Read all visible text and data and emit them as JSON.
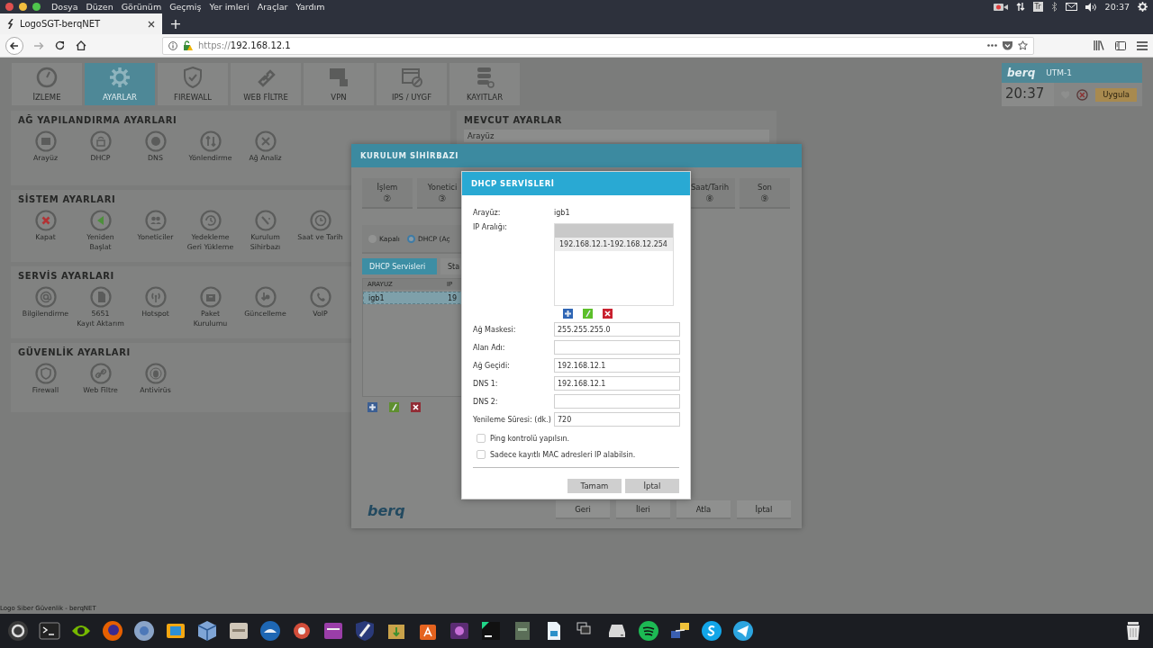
{
  "os_menu": [
    "Dosya",
    "Düzen",
    "Görünüm",
    "Geçmiş",
    "Yer imleri",
    "Araçlar",
    "Yardım"
  ],
  "os_tray": {
    "keyboard": "Tr",
    "clock": "20:37"
  },
  "browser": {
    "tab_title": "LogoSGT-berqNET",
    "new_tab": "+",
    "url_scheme": "https://",
    "url_host": "192.168.12.1"
  },
  "nav_tiles": [
    {
      "label": "İZLEME",
      "selected": false
    },
    {
      "label": "AYARLAR",
      "selected": true
    },
    {
      "label": "FIREWALL",
      "selected": false
    },
    {
      "label": "WEB FİLTRE",
      "selected": false
    },
    {
      "label": "VPN",
      "selected": false
    },
    {
      "label": "IPS / UYGF",
      "selected": false
    },
    {
      "label": "KAYITLAR",
      "selected": false
    }
  ],
  "device_widget": {
    "brand": "berq",
    "model": "UTM-1",
    "clock": "20:37",
    "apply": "Uygula"
  },
  "sections": [
    {
      "title": "AĞ YAPILANDIRMA AYARLARI",
      "items": [
        "Arayüz",
        "DHCP",
        "DNS",
        "Yönlendirme",
        "Ağ Analiz"
      ]
    },
    {
      "title": "SİSTEM AYARLARI",
      "items": [
        "Kapat",
        "Yeniden\nBaşlat",
        "Yoneticiler",
        "Yedekleme\nGeri Yükleme",
        "Kurulum\nSihirbazı",
        "Saat ve Tarih"
      ]
    },
    {
      "title": "SERVİS AYARLARI",
      "items": [
        "Bilgilendirme",
        "5651\nKayıt Aktarım",
        "Hotspot",
        "Paket\nKurulumu",
        "Güncelleme",
        "VoIP"
      ]
    },
    {
      "title": "GÜVENLİK AYARLARI",
      "items": [
        "Firewall",
        "Web Filtre",
        "Antivirüs"
      ]
    }
  ],
  "current_settings": {
    "title": "MEVCUT AYARLAR",
    "rows": [
      "Arayüz"
    ]
  },
  "wizard": {
    "title": "KURULUM SİHİRBAZI",
    "steps_left": [
      {
        "label": "İşlem",
        "number": "②"
      },
      {
        "label": "Yonetici",
        "number": "③"
      }
    ],
    "steps_right": [
      {
        "label": "Saat/Tarih",
        "number": "⑧"
      },
      {
        "label": "Son",
        "number": "⑨"
      }
    ],
    "radios": [
      {
        "label": "Kapalı",
        "selected": false
      },
      {
        "label": "DHCP (Aç",
        "selected": true
      }
    ],
    "tabs": [
      {
        "label": "DHCP Servisleri",
        "selected": true
      },
      {
        "label": "Sta",
        "selected": false
      }
    ],
    "table": {
      "columns": [
        "ARAYUZ",
        "IP"
      ],
      "rows": [
        {
          "cells": [
            "igb1",
            "19"
          ],
          "selected": true
        }
      ]
    },
    "logo": "berq",
    "buttons": [
      "Geri",
      "İleri",
      "Atla",
      "İptal"
    ]
  },
  "dialog": {
    "title": "DHCP SERVİSLERİ",
    "fields": [
      {
        "kind": "text",
        "label": "Arayüz:",
        "value": "igb1"
      },
      {
        "kind": "list",
        "label": "IP Aralığı:",
        "items": [
          "192.168.12.1-192.168.12.254"
        ]
      },
      {
        "kind": "input",
        "label": "Ağ Maskesi:",
        "value": "255.255.255.0"
      },
      {
        "kind": "input",
        "label": "Alan Adı:"
      },
      {
        "kind": "input",
        "label": "Ağ Geçidi:",
        "value": "192.168.12.1"
      },
      {
        "kind": "input",
        "label": "DNS 1:",
        "value": "192.168.12.1"
      },
      {
        "kind": "input",
        "label": "DNS 2:"
      },
      {
        "kind": "input",
        "label": "Yenileme Süresi: (dk.)",
        "value": "720"
      }
    ],
    "checkboxes": [
      {
        "label": "Ping kontrolü yapılsın.",
        "checked": false
      },
      {
        "label": "Sadece kayıtlı MAC adresleri IP alabilsin.",
        "checked": false
      }
    ],
    "buttons": [
      "Tamam",
      "İptal"
    ]
  },
  "status_text": "Logo Siber Güvenlik - berqNET"
}
